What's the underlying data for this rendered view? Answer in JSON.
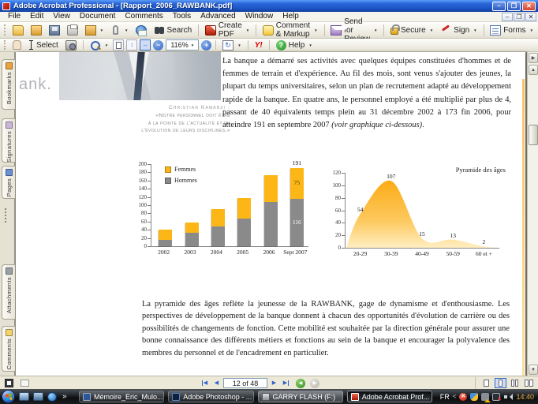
{
  "titlebar": {
    "title": "Adobe Acrobat Professional - [Rapport_2006_RAWBANK.pdf]"
  },
  "menubar": {
    "items": [
      "File",
      "Edit",
      "View",
      "Document",
      "Comments",
      "Tools",
      "Advanced",
      "Window",
      "Help"
    ]
  },
  "toolbar_file": {
    "search": "Search",
    "create_pdf": "Create PDF",
    "comment_markup": "Comment & Markup",
    "send_for_review": "Send for Review",
    "secure": "Secure",
    "sign": "Sign",
    "forms": "Forms"
  },
  "toolbar_view": {
    "select": "Select",
    "zoom_level": "116%",
    "yahoo": "Y!",
    "help": "Help"
  },
  "nav_tabs": {
    "top": [
      "Bookmarks",
      "Signatures",
      "Pages"
    ],
    "bottom": [
      "Attachments",
      "Comments"
    ]
  },
  "page": {
    "watermark": "ank.",
    "quote_line1": "Christian Kamanzi :",
    "quote_line2": "«Notre personnel doit être",
    "quote_line3": "à la pointe de l'actualité et de",
    "quote_line4": "l'évolution de leurs disciplines.»",
    "para1_main": "La banque a démarré ses activités avec quelques équipes constituées d'hommes et de femmes de terrain et d'expérience. Au fil des mois, sont venus s'ajouter des jeunes, la plupart du temps universitaires, selon un plan de recrutement adapté au développement rapide de la banque. En quatre ans, le personnel employé a été multiplié par plus de 4, passant de 40 équivalents temps plein au 31 décembre 2002 à 173 fin 2006, pour atteindre 191 en septembre 2007",
    "para1_italic": " (voir graphique ci-dessous)",
    "para1_period": ".",
    "para2": "La pyramide des âges reflète la jeunesse de la RAWBANK, gage de dynamisme et d'enthousiasme. Les perspectives de développement de la banque donnent à chacun des opportunités d'évolution de carrière ou des possibilités de changements de fonction. Cette mobilité est souhaitée par la direction générale pour assurer une bonne connaissance des différents métiers et fonctions au sein de la banque et encourager la polyvalence des membres du personnel et de l'encadrement en particulier."
  },
  "chart_data": [
    {
      "type": "bar",
      "stacked": true,
      "title": "",
      "categories": [
        "2002",
        "2003",
        "2004",
        "2005",
        "2006",
        "Sept 2007"
      ],
      "series": [
        {
          "name": "Hommes",
          "color": "#8a8a8a",
          "values": [
            15,
            33,
            48,
            68,
            108,
            116
          ]
        },
        {
          "name": "Femmes",
          "color": "#fcb717",
          "values": [
            25,
            24,
            42,
            49,
            65,
            75
          ]
        }
      ],
      "legend_order": [
        "Femmes",
        "Hommes"
      ],
      "legend_position": "top-left",
      "ylim": [
        0,
        200
      ],
      "ytick_step": 20,
      "grid": false,
      "last_bar_value_labels": true
    },
    {
      "type": "area",
      "title": "Pyramide des âges",
      "categories": [
        "20-29",
        "30-39",
        "40-49",
        "50-59",
        "60 et +"
      ],
      "values": [
        54,
        107,
        15,
        13,
        2
      ],
      "ylim": [
        0,
        120
      ],
      "ytick_step": 20,
      "grid": false,
      "fill_color": "#fcb717",
      "point_labels": true
    }
  ],
  "statusbar": {
    "page_indicator": "12 of 48"
  },
  "taskbar": {
    "more_chevron": "»",
    "buttons": [
      {
        "icon": "word-doc-icon",
        "style": "word",
        "label": "Mémoire_Eric_Mulo..."
      },
      {
        "icon": "photoshop-icon",
        "style": "ps",
        "label": "Adobe Photoshop - ..."
      },
      {
        "icon": "drive-icon",
        "style": "drive",
        "label": "GARRY FLASH (F:)",
        "light": true
      },
      {
        "icon": "acrobat-icon",
        "style": "acro",
        "label": "Adobe Acrobat Prof...",
        "active": true
      }
    ],
    "tray": {
      "language": "FR",
      "chevron": "<",
      "time": "14:40"
    }
  },
  "colors": {
    "accent_yellow": "#fcb717",
    "bar_gray": "#8a8a8a",
    "titlebar_blue": "#1c55c6"
  }
}
